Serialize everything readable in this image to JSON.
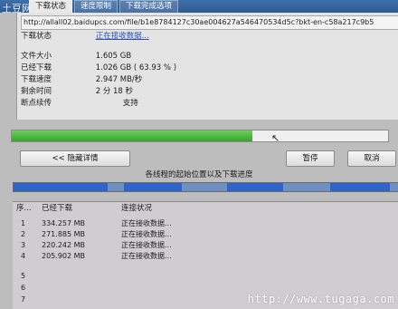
{
  "watermark_top": "土豆网",
  "tabs": [
    "下载状态",
    "速度限制",
    "下载完成选项"
  ],
  "url": "http://allall02.baidupcs.com/file/b1e8784127c30ae004627a546470534d5c?bkt-en-c58a217c9b5",
  "status": {
    "label": "下载状态",
    "value": "正在接收数据..."
  },
  "info": [
    {
      "label": "文件大小",
      "value": "1.605  GB"
    },
    {
      "label": "已经下载",
      "value": "1.026  GB  ( 63.93 % )"
    },
    {
      "label": "下载速度",
      "value": "2.947  MB/秒"
    },
    {
      "label": "剩余时间",
      "value": "2 分 18 秒"
    },
    {
      "label": "断点续传",
      "value": "支持"
    }
  ],
  "progress": 0.6393,
  "buttons": {
    "details": "<< 隐藏详情",
    "pause": "暂停",
    "cancel": "取消"
  },
  "segments_caption": "各线程的起始位置以及下载进度",
  "table": {
    "headers": [
      "序...",
      "已经下载",
      "连接状况"
    ],
    "rows": [
      {
        "num": "1",
        "downloaded": "334.257  MB",
        "status": "正在接收数据..."
      },
      {
        "num": "2",
        "downloaded": "271.885  MB",
        "status": "正在接收数据..."
      },
      {
        "num": "3",
        "downloaded": "220.242  MB",
        "status": "正在接收数据..."
      },
      {
        "num": "4",
        "downloaded": "205.902  MB",
        "status": "正在接收数据..."
      },
      {
        "num": "5",
        "downloaded": "",
        "status": ""
      },
      {
        "num": "6",
        "downloaded": "",
        "status": ""
      },
      {
        "num": "7",
        "downloaded": "",
        "status": ""
      }
    ]
  },
  "watermark_bottom": "http://www.tugaga.com",
  "colors": {
    "progress_green": "#38a22c",
    "segment_blue": "#2f64c9",
    "link": "#2b52b8"
  }
}
